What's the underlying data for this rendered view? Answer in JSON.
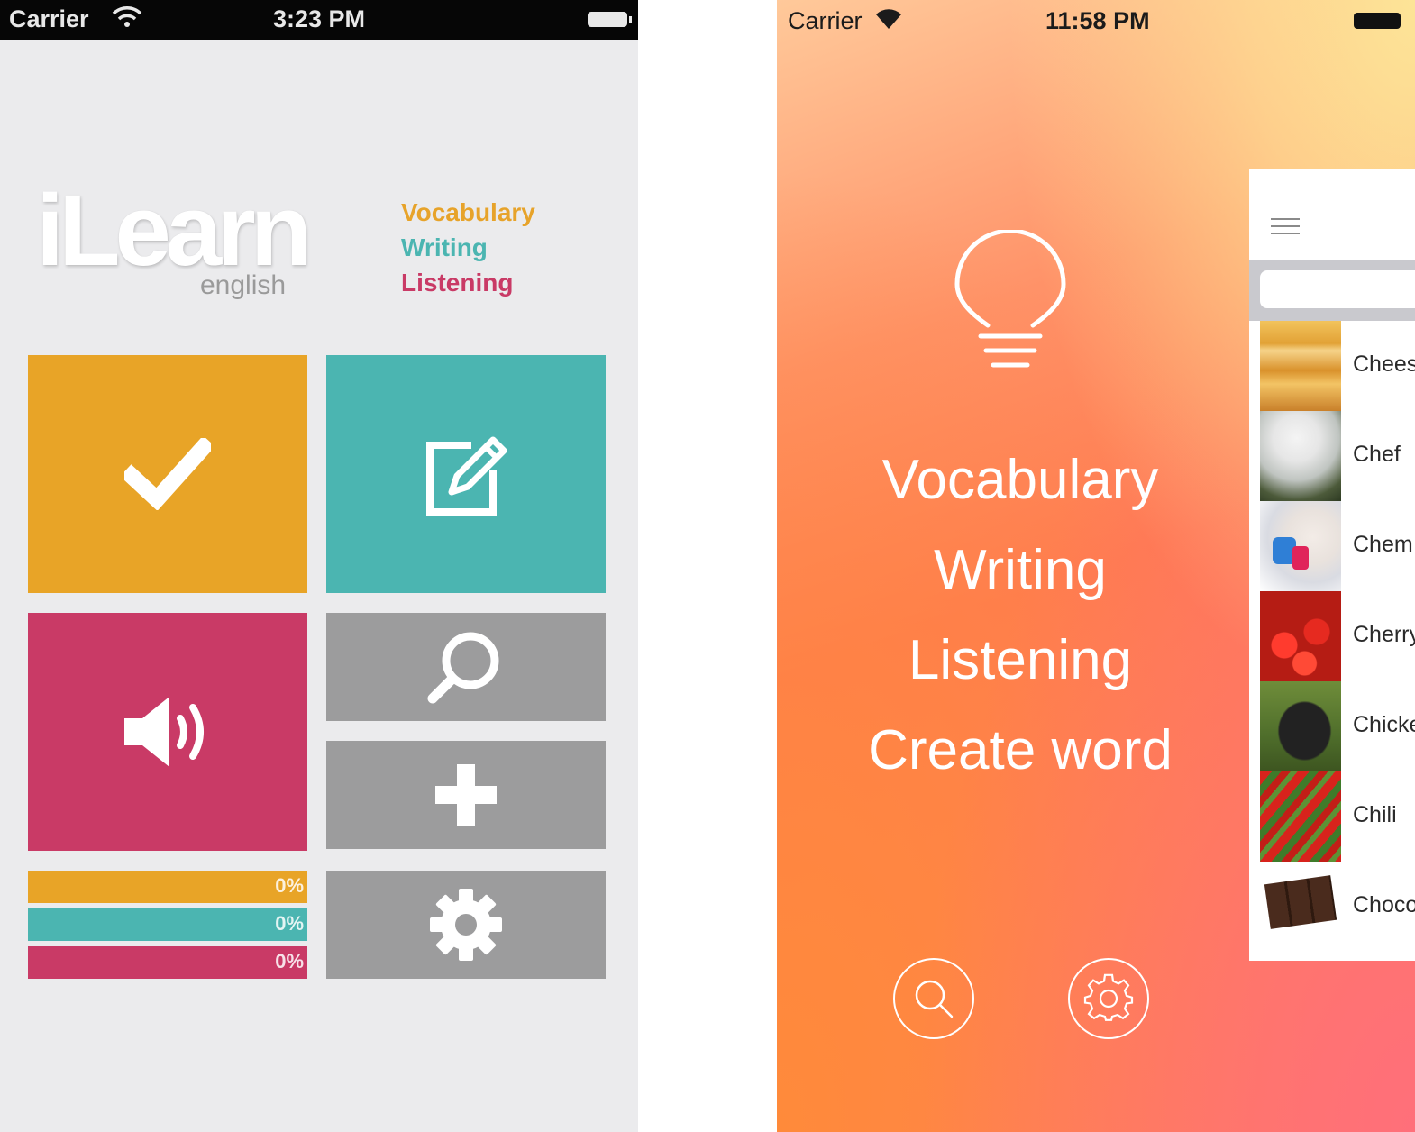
{
  "left_app": {
    "status_bar": {
      "carrier": "Carrier",
      "time": "3:23 PM"
    },
    "logo": {
      "title": "iLearn",
      "subtitle": "english"
    },
    "nav": {
      "vocabulary": "Vocabulary",
      "writing": "Writing",
      "listening": "Listening"
    },
    "tiles": {
      "vocabulary_icon": "checkmark-icon",
      "writing_icon": "edit-icon",
      "listening_icon": "speaker-icon",
      "search_icon": "search-icon",
      "add_icon": "plus-icon",
      "settings_icon": "gear-icon"
    },
    "progress": [
      {
        "label": "0%",
        "value": 0,
        "color": "#e8a427"
      },
      {
        "label": "0%",
        "value": 0,
        "color": "#4bb5b1"
      },
      {
        "label": "0%",
        "value": 0,
        "color": "#c93a66"
      }
    ],
    "colors": {
      "vocabulary": "#e8a427",
      "writing": "#4bb5b1",
      "listening": "#c93a66",
      "utility": "#9c9c9d"
    }
  },
  "right_app": {
    "status_bar": {
      "carrier": "Carrier",
      "time": "11:58 PM"
    },
    "menu": {
      "vocabulary": "Vocabulary",
      "writing": "Writing",
      "listening": "Listening",
      "create_word": "Create word"
    },
    "icons": {
      "logo": "lightbulb-icon",
      "search": "search-icon",
      "settings": "gear-icon",
      "menu": "hamburger-icon"
    },
    "word_list": [
      {
        "label": "Chees",
        "thumb": "cheese"
      },
      {
        "label": "Chef",
        "thumb": "chef"
      },
      {
        "label": "Chem",
        "thumb": "chemist"
      },
      {
        "label": "Cherry",
        "thumb": "cherry"
      },
      {
        "label": "Chicke",
        "thumb": "chicken"
      },
      {
        "label": "Chili",
        "thumb": "chili"
      },
      {
        "label": "Choco",
        "thumb": "chocolate"
      }
    ]
  }
}
